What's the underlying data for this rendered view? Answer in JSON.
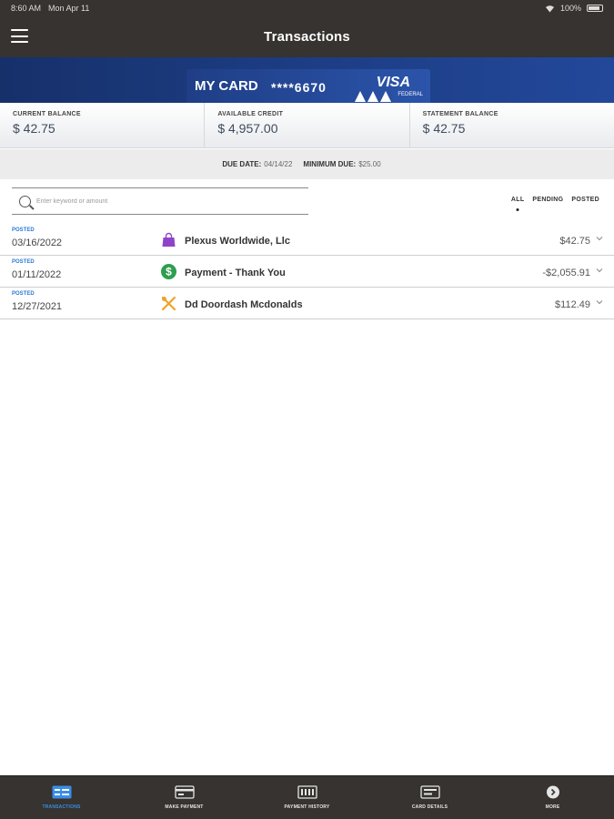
{
  "status_bar": {
    "time": "8:60 AM",
    "date": "Mon Apr 11",
    "battery": "100%"
  },
  "nav": {
    "title": "Transactions"
  },
  "card": {
    "name": "MY CARD",
    "number": "****6670",
    "brand": "VISA",
    "brand_sub": "FEDERAL"
  },
  "balances": [
    {
      "label": "CURRENT BALANCE",
      "value": "$ 42.75"
    },
    {
      "label": "AVAILABLE CREDIT",
      "value": "$ 4,957.00"
    },
    {
      "label": "STATEMENT BALANCE",
      "value": "$ 42.75"
    }
  ],
  "due": {
    "due_label": "DUE DATE:",
    "due_value": "04/14/22",
    "min_label": "MINIMUM DUE:",
    "min_value": "$25.00"
  },
  "search": {
    "placeholder": "Enter keyword or amount"
  },
  "filters": {
    "all": "ALL",
    "pending": "PENDING",
    "posted": "POSTED",
    "selected": "ALL"
  },
  "transactions": [
    {
      "status": "POSTED",
      "date": "03/16/2022",
      "icon": "shopping-bag-icon",
      "icon_color": "#8e44c9",
      "description": "Plexus Worldwide, Llc",
      "amount": "$42.75"
    },
    {
      "status": "POSTED",
      "date": "01/11/2022",
      "icon": "dollar-icon",
      "icon_color": "#2e9e4f",
      "description": "Payment - Thank You",
      "amount": "-$2,055.91"
    },
    {
      "status": "POSTED",
      "date": "12/27/2021",
      "icon": "fork-knife-icon",
      "icon_color": "#f0a428",
      "description": "Dd Doordash Mcdonalds",
      "amount": "$112.49"
    }
  ],
  "tabs": [
    {
      "label": "TRANSACTIONS",
      "icon": "transactions-icon",
      "active": true
    },
    {
      "label": "MAKE PAYMENT",
      "icon": "make-payment-icon",
      "active": false
    },
    {
      "label": "PAYMENT HISTORY",
      "icon": "payment-history-icon",
      "active": false
    },
    {
      "label": "CARD DETAILS",
      "icon": "card-details-icon",
      "active": false
    },
    {
      "label": "MORE",
      "icon": "more-icon",
      "active": false
    }
  ],
  "colors": {
    "header": "#363330",
    "accent": "#3b8ee6",
    "status_posted": "#2a7bd4"
  }
}
